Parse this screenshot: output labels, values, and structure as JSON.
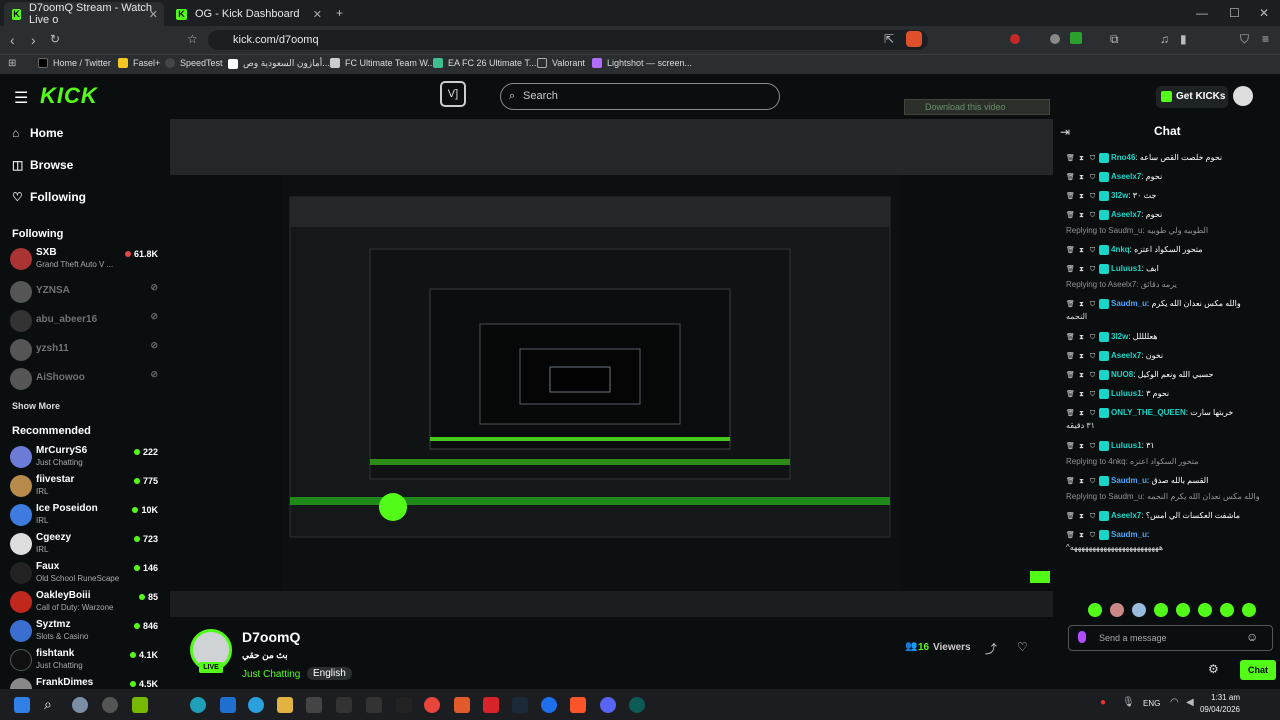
{
  "browser": {
    "tabs": [
      {
        "label": "D7oomQ Stream - Watch Live o"
      },
      {
        "label": "OG - Kick Dashboard"
      }
    ],
    "url": "kick.com/d7oomq",
    "bookmarks": [
      "Home / Twitter",
      "Fasel+",
      "SpeedTest",
      "أمازون السعودية وص...",
      "FC Ultimate Team W...",
      "EA FC 26 Ultimate T...",
      "Valorant",
      "Lightshot — screen..."
    ]
  },
  "header": {
    "search_placeholder": "Search",
    "get_kicks": "Get KICKs"
  },
  "sidebar": {
    "nav": [
      {
        "label": "Home"
      },
      {
        "label": "Browse"
      },
      {
        "label": "Following"
      }
    ],
    "following_title": "Following",
    "following": [
      {
        "name": "SXB",
        "category": "Grand Theft Auto V ...",
        "viewers": "61.8K"
      },
      {
        "name": "YZNSA"
      },
      {
        "name": "abu_abeer16"
      },
      {
        "name": "yzsh11"
      },
      {
        "name": "AiShowoo"
      }
    ],
    "show_more": "Show More",
    "recommended_title": "Recommended",
    "recommended": [
      {
        "name": "MrCurryS6",
        "category": "Just Chatting",
        "viewers": "222"
      },
      {
        "name": "fiivestar",
        "category": "IRL",
        "viewers": "775"
      },
      {
        "name": "Ice Poseidon",
        "category": "IRL",
        "viewers": "10K"
      },
      {
        "name": "Cgeezy",
        "category": "IRL",
        "viewers": "723"
      },
      {
        "name": "Faux",
        "category": "Old School RuneScape",
        "viewers": "146"
      },
      {
        "name": "OakleyBoiii",
        "category": "Call of Duty: Warzone",
        "viewers": "85"
      },
      {
        "name": "Syztmz",
        "category": "Slots & Casino",
        "viewers": "846"
      },
      {
        "name": "fishtank",
        "category": "Just Chatting",
        "viewers": "4.1K"
      },
      {
        "name": "FrankDimes",
        "category": "",
        "viewers": "4.5K"
      }
    ]
  },
  "overlay": {
    "download": "Download this video"
  },
  "stream": {
    "streamer": "D7oomQ",
    "title": "بث من حقي",
    "category": "Just Chatting",
    "language": "English",
    "live": "LIVE",
    "viewers_count": "16",
    "viewers_label": "Viewers"
  },
  "chat": {
    "title": "Chat",
    "messages": [
      {
        "type": "msg",
        "user": "Rno46",
        "color": "#18d5c8",
        "text": "نحوم خلصت القص ساعه"
      },
      {
        "type": "msg",
        "user": "Aseelx7",
        "color": "#18d5c8",
        "text": "نحوم"
      },
      {
        "type": "msg",
        "user": "3l2w",
        "color": "#18d5c8",
        "text": "جث ٣٠"
      },
      {
        "type": "msg",
        "user": "Aseelx7",
        "color": "#18d5c8",
        "text": "نحوم"
      },
      {
        "type": "reply",
        "text": "Replying to Saudm_u: الطوبيه ولي طوبيه"
      },
      {
        "type": "msg",
        "user": "4nkq",
        "color": "#18d5c8",
        "text": "متحور السكواد اعتزه"
      },
      {
        "type": "msg",
        "user": "Luluus1",
        "color": "#18d5c8",
        "text": "ابف"
      },
      {
        "type": "reply",
        "text": "Replying to Aseelx7: يرمه دقائق"
      },
      {
        "type": "msg",
        "user": "Saudm_u",
        "color": "#4aa7ff",
        "text": "والله مكس نعدان الله يكرم"
      },
      {
        "type": "extra",
        "text": "النحمه"
      },
      {
        "type": "msg",
        "user": "3l2w",
        "color": "#18d5c8",
        "text": "هعللللل"
      },
      {
        "type": "msg",
        "user": "Aseelx7",
        "color": "#18d5c8",
        "text": "نخون"
      },
      {
        "type": "msg",
        "user": "NUO8",
        "color": "#18d5c8",
        "text": "حسبي الله ونعم الوكيل"
      },
      {
        "type": "msg",
        "user": "Luluus1",
        "color": "#18d5c8",
        "text": "نحوم ٣"
      },
      {
        "type": "msg",
        "user": "ONLY_THE_QUEEN",
        "color": "#18d5c8",
        "text": "خربتها سارت"
      },
      {
        "type": "extra",
        "text": "٣١ دقيقه"
      },
      {
        "type": "msg",
        "user": "Luluus1",
        "color": "#18d5c8",
        "text": "٣١"
      },
      {
        "type": "reply",
        "text": "Replying to 4nkq: متحور السكواد اعتزه"
      },
      {
        "type": "msg",
        "user": "Saudm_u",
        "color": "#4aa7ff",
        "text": "القسم بالله صدق"
      },
      {
        "type": "reply",
        "text": "Replying to Saudm_u: والله مكس نعدان الله يكرم النحمه"
      },
      {
        "type": "msg",
        "user": "Aseelx7",
        "color": "#18d5c8",
        "text": "ماشفت العكسات الي امس؟"
      },
      {
        "type": "msg",
        "user": "Saudm_u",
        "color": "#4aa7ff",
        "text": ""
      },
      {
        "type": "extra",
        "text": "^ههههههههههههههههههههههههه"
      }
    ],
    "input_placeholder": "Send a message",
    "send_label": "Chat"
  },
  "taskbar": {
    "lang": "ENG",
    "time": "1:31 am",
    "date": "09/04/2026"
  }
}
